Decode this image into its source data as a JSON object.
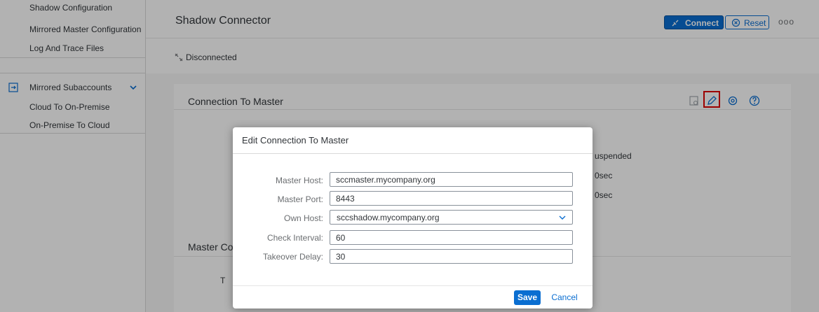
{
  "sidebar": {
    "items": [
      {
        "label": "Shadow Configuration"
      },
      {
        "label": "Mirrored Master Configuration"
      },
      {
        "label": "Log And Trace Files"
      },
      {
        "label": "Mirrored Subaccounts"
      },
      {
        "label": "Cloud To On-Premise"
      },
      {
        "label": "On-Premise To Cloud"
      }
    ],
    "group_icon": "subaccount-icon",
    "expand_icon": "chevron-down-icon"
  },
  "header": {
    "title": "Shadow Connector",
    "connect_label": "Connect",
    "reset_label": "Reset",
    "more": "ooo"
  },
  "status": {
    "text": "Disconnected",
    "icon": "disconnected-icon"
  },
  "section": {
    "title": "Connection To Master",
    "icons": [
      "history-icon",
      "edit-icon",
      "settings-icon",
      "help-icon"
    ],
    "background_values": [
      "uspended",
      "0sec",
      "0sec"
    ],
    "second_title_partial": "Master Co",
    "partial_letter": "T"
  },
  "dialog": {
    "title": "Edit Connection To Master",
    "fields": [
      {
        "label": "Master Host:",
        "value": "sccmaster.mycompany.org"
      },
      {
        "label": "Master Port:",
        "value": "8443"
      },
      {
        "label": "Own Host:",
        "value": "sccshadow.mycompany.org"
      },
      {
        "label": "Check Interval:",
        "value": "60"
      },
      {
        "label": "Takeover Delay:",
        "value": "30"
      }
    ],
    "save_label": "Save",
    "cancel_label": "Cancel"
  },
  "colors": {
    "accent": "#0a6ed1",
    "highlight": "#e00000"
  }
}
